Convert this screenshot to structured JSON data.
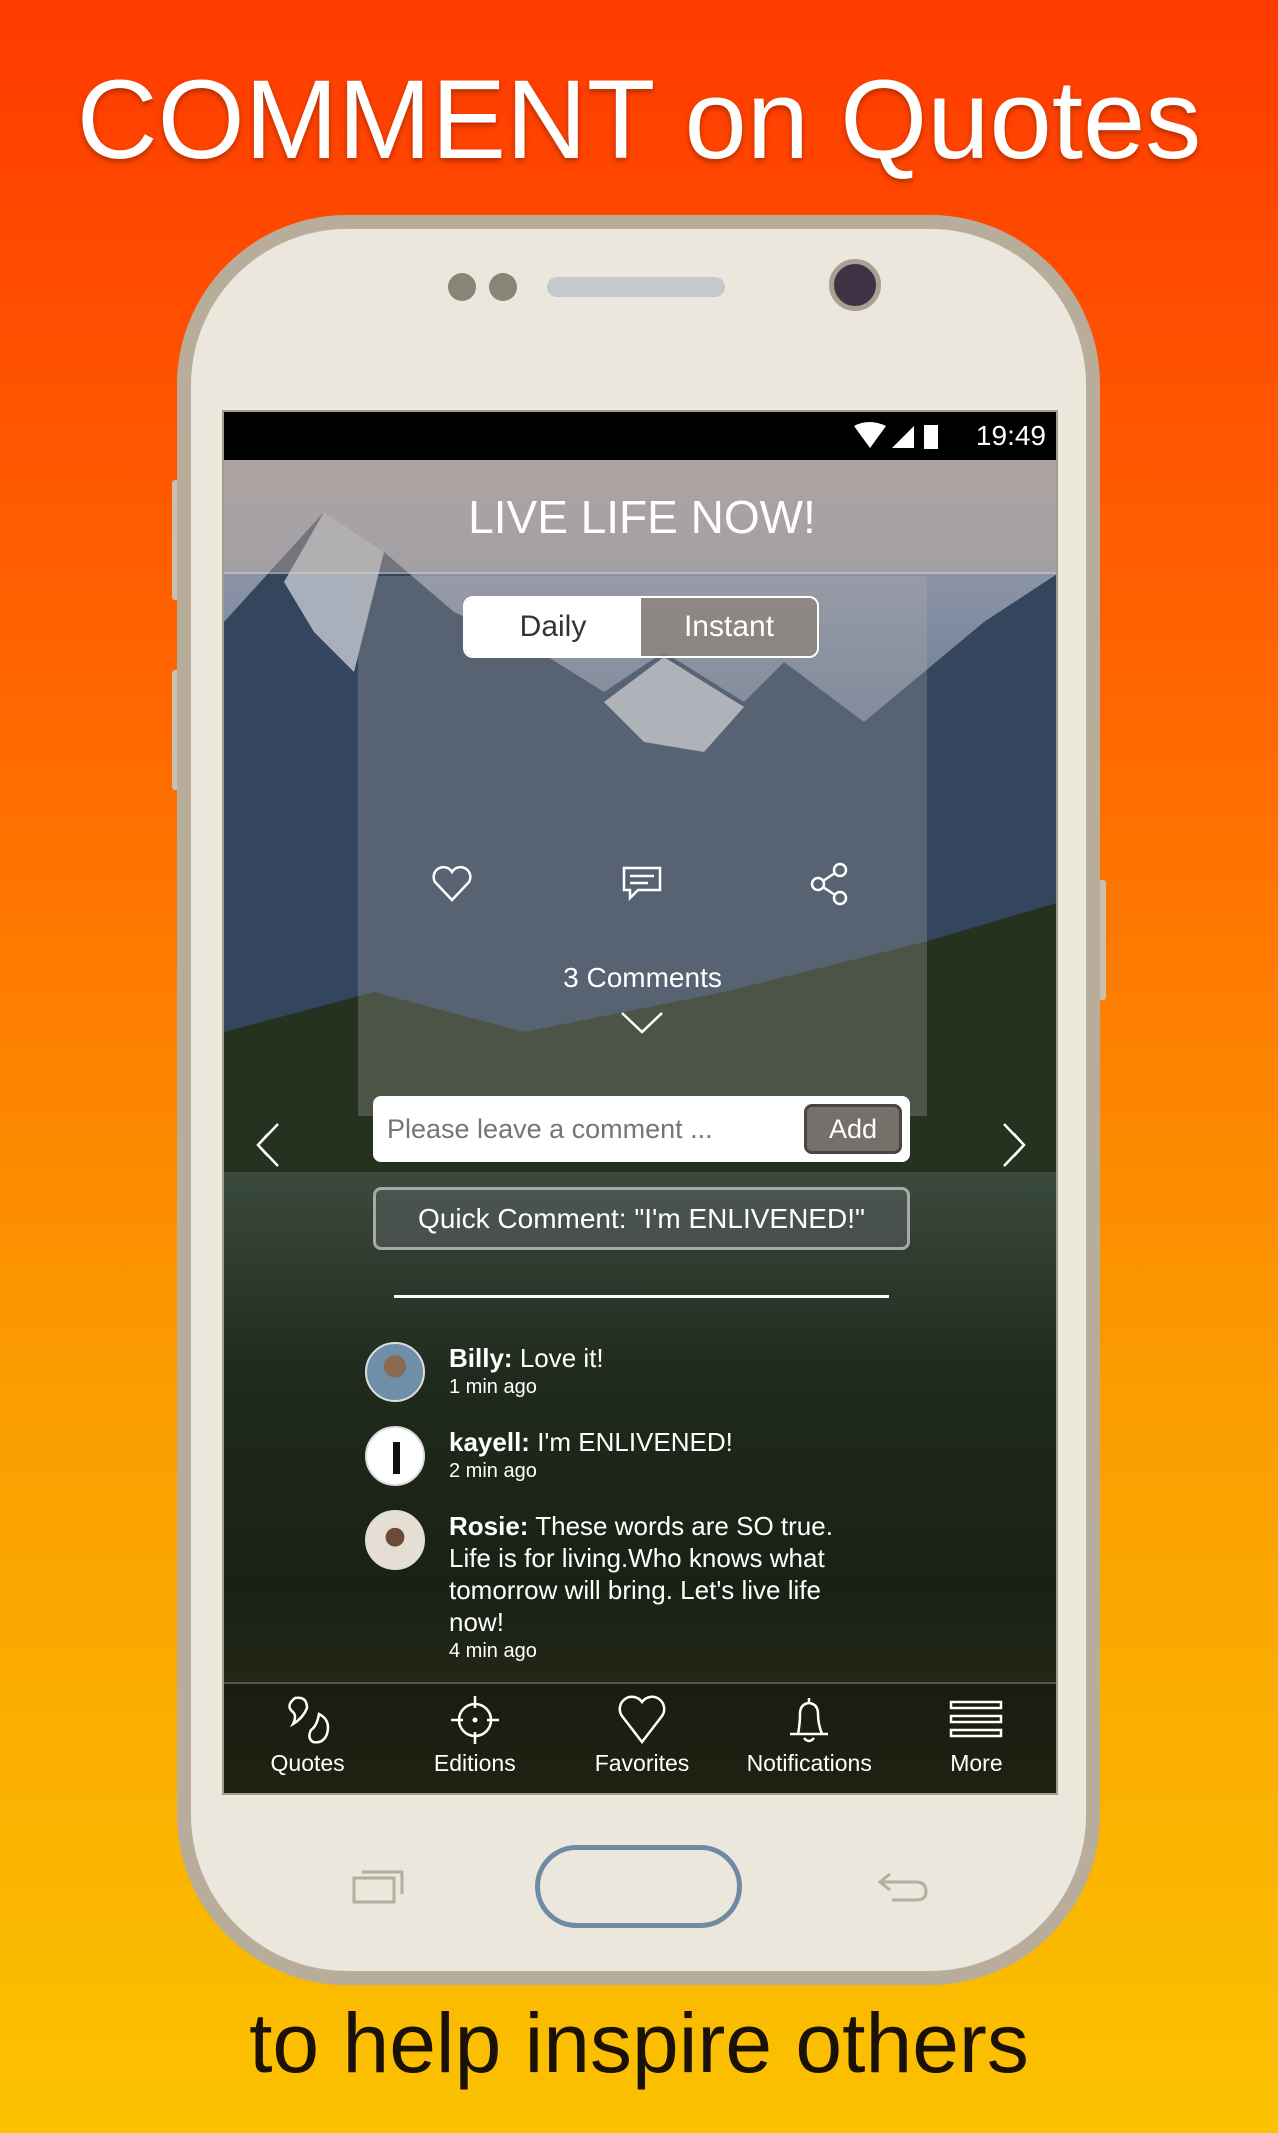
{
  "promo": {
    "headline": "COMMENT on Quotes",
    "footer": "to help inspire others"
  },
  "status_bar": {
    "time": "19:49",
    "icons": [
      "wifi-icon",
      "signal-icon",
      "battery-icon"
    ]
  },
  "header": {
    "title": "LIVE LIFE NOW!"
  },
  "toggle": {
    "daily": "Daily",
    "instant": "Instant",
    "selected": "Daily"
  },
  "actions": {
    "icons": [
      "heart-icon",
      "comment-icon",
      "share-icon"
    ]
  },
  "comments_count": "3 Comments",
  "comment_input": {
    "placeholder": "Please leave a comment ...",
    "value": "",
    "add_label": "Add"
  },
  "quick_comment": "Quick Comment: \"I'm ENLIVENED!\"",
  "comments": [
    {
      "user": "Billy:",
      "text": "Love it!",
      "time": "1 min ago"
    },
    {
      "user": "kayell:",
      "text": "I'm ENLIVENED!",
      "time": "2 min ago"
    },
    {
      "user": "Rosie:",
      "text": "These words are SO true. Life is for living.Who knows what tomorrow will bring. Let's live life now!",
      "time": "4 min ago"
    }
  ],
  "nav": [
    {
      "label": "Quotes",
      "icon": "quotes-icon"
    },
    {
      "label": "Editions",
      "icon": "crosshair-icon"
    },
    {
      "label": "Favorites",
      "icon": "heart-icon"
    },
    {
      "label": "Notifications",
      "icon": "bell-icon"
    },
    {
      "label": "More",
      "icon": "menu-icon"
    }
  ],
  "colors": {
    "bg_top": "#ff3a00",
    "bg_bottom": "#fbc200",
    "phone": "#ebe7dc",
    "home_button": "#6f8aa3"
  }
}
